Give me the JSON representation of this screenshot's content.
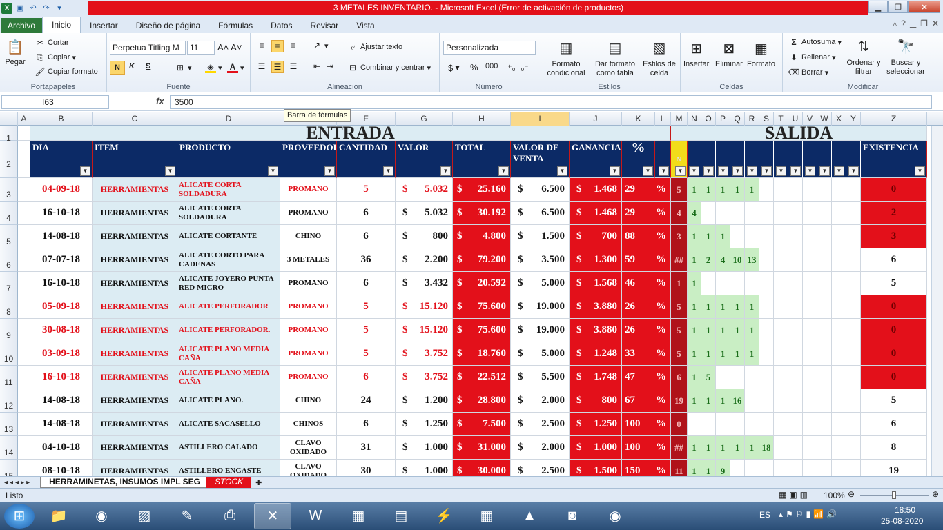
{
  "window": {
    "title": "3 METALES INVENTARIO.  -  Microsoft Excel (Error de activación de productos)"
  },
  "tabs": [
    "Archivo",
    "Inicio",
    "Insertar",
    "Diseño de página",
    "Fórmulas",
    "Datos",
    "Revisar",
    "Vista"
  ],
  "ribbon": {
    "portapapeles": {
      "label": "Portapapeles",
      "paste": "Pegar",
      "cut": "Cortar",
      "copy": "Copiar",
      "format_painter": "Copiar formato"
    },
    "fuente": {
      "label": "Fuente",
      "font": "Perpetua Titling M",
      "size": "11",
      "bold": "N",
      "italic": "K",
      "underline": "S"
    },
    "alineacion": {
      "label": "Alineación",
      "wrap": "Ajustar texto",
      "merge": "Combinar y centrar"
    },
    "numero": {
      "label": "Número",
      "format": "Personalizada",
      "currency": "$",
      "percent": "%",
      "thousands": "000"
    },
    "estilos": {
      "label": "Estilos",
      "conditional": "Formato condicional",
      "table": "Dar formato como tabla",
      "cell_styles": "Estilos de celda"
    },
    "celdas": {
      "label": "Celdas",
      "insert": "Insertar",
      "delete": "Eliminar",
      "format": "Formato"
    },
    "modificar": {
      "label": "Modificar",
      "autosum": "Autosuma",
      "fill": "Rellenar",
      "clear": "Borrar",
      "sort": "Ordenar y filtrar",
      "find": "Buscar y seleccionar"
    }
  },
  "formula_bar": {
    "name_box": "I63",
    "fx": "fx",
    "value": "3500",
    "tooltip": "Barra de fórmulas"
  },
  "columns": [
    "A",
    "B",
    "C",
    "D",
    "E",
    "F",
    "G",
    "H",
    "I",
    "J",
    "K",
    "L",
    "M",
    "N",
    "O",
    "P",
    "Q",
    "R",
    "S",
    "T",
    "U",
    "V",
    "W",
    "X",
    "Y",
    "Z"
  ],
  "headers": {
    "entrada": "ENTRADA",
    "salida": "SALIDA",
    "dia": "DIA",
    "item": "ITEM",
    "producto": "PRODUCTO",
    "proveedor": "PROVEEDOR",
    "cantidad": "CANTIDAD",
    "valor": "VALOR",
    "total": "TOTAL",
    "valor_venta": "VALOR DE VENTA",
    "ganancia": "GANANCIA",
    "pct": "%",
    "n": "N",
    "existencia": "EXISTENCIA"
  },
  "rows": [
    {
      "r": "3",
      "dia": "04-09-18",
      "item": "HERRAMIENTAS",
      "producto": "ALICATE CORTA SOLDADURA",
      "proveedor": "PROMANO",
      "cantidad": "5",
      "valor": "5.032",
      "total": "25.160",
      "venta": "6.500",
      "ganancia": "1.468",
      "pct": "29",
      "n": "5",
      "salidas": [
        "1",
        "1",
        "1",
        "1",
        "1"
      ],
      "exist": "0",
      "red": true
    },
    {
      "r": "4",
      "dia": "16-10-18",
      "item": "HERRAMIENTAS",
      "producto": "ALICATE CORTA SOLDADURA",
      "proveedor": "PROMANO",
      "cantidad": "6",
      "valor": "5.032",
      "total": "30.192",
      "venta": "6.500",
      "ganancia": "1.468",
      "pct": "29",
      "n": "4",
      "salidas": [
        "4"
      ],
      "exist": "2",
      "red": false
    },
    {
      "r": "5",
      "dia": "14-08-18",
      "item": "HERRAMIENTAS",
      "producto": "ALICATE CORTANTE",
      "proveedor": "CHINO",
      "cantidad": "6",
      "valor": "800",
      "total": "4.800",
      "venta": "1.500",
      "ganancia": "700",
      "pct": "88",
      "n": "3",
      "salidas": [
        "1",
        "1",
        "1"
      ],
      "exist": "3",
      "red": false
    },
    {
      "r": "6",
      "dia": "07-07-18",
      "item": "HERRAMIENTAS",
      "producto": "ALICATE CORTO PARA CADENAS",
      "proveedor": "3 METALES",
      "cantidad": "36",
      "valor": "2.200",
      "total": "79.200",
      "venta": "3.500",
      "ganancia": "1.300",
      "pct": "59",
      "n": "##",
      "salidas": [
        "1",
        "2",
        "4",
        "10",
        "13"
      ],
      "exist": "6",
      "red": false
    },
    {
      "r": "7",
      "dia": "16-10-18",
      "item": "HERRAMIENTAS",
      "producto": "ALICATE JOYERO PUNTA RED MICRO",
      "proveedor": "PROMANO",
      "cantidad": "6",
      "valor": "3.432",
      "total": "20.592",
      "venta": "5.000",
      "ganancia": "1.568",
      "pct": "46",
      "n": "1",
      "salidas": [
        "1"
      ],
      "exist": "5",
      "red": false
    },
    {
      "r": "8",
      "dia": "05-09-18",
      "item": "HERRAMIENTAS",
      "producto": "ALICATE PERFORADOR",
      "proveedor": "PROMANO",
      "cantidad": "5",
      "valor": "15.120",
      "total": "75.600",
      "venta": "19.000",
      "ganancia": "3.880",
      "pct": "26",
      "n": "5",
      "salidas": [
        "1",
        "1",
        "1",
        "1",
        "1"
      ],
      "exist": "0",
      "red": true
    },
    {
      "r": "9",
      "dia": "30-08-18",
      "item": "HERRAMIENTAS",
      "producto": "ALICATE PERFORADOR.",
      "proveedor": "PROMANO",
      "cantidad": "5",
      "valor": "15.120",
      "total": "75.600",
      "venta": "19.000",
      "ganancia": "3.880",
      "pct": "26",
      "n": "5",
      "salidas": [
        "1",
        "1",
        "1",
        "1",
        "1"
      ],
      "exist": "0",
      "red": true
    },
    {
      "r": "10",
      "dia": "03-09-18",
      "item": "HERRAMIENTAS",
      "producto": "ALICATE PLANO MEDIA CAÑA",
      "proveedor": "PROMANO",
      "cantidad": "5",
      "valor": "3.752",
      "total": "18.760",
      "venta": "5.000",
      "ganancia": "1.248",
      "pct": "33",
      "n": "5",
      "salidas": [
        "1",
        "1",
        "1",
        "1",
        "1"
      ],
      "exist": "0",
      "red": true
    },
    {
      "r": "11",
      "dia": "16-10-18",
      "item": "HERRAMIENTAS",
      "producto": "ALICATE PLANO MEDIA CAÑA",
      "proveedor": "PROMANO",
      "cantidad": "6",
      "valor": "3.752",
      "total": "22.512",
      "venta": "5.500",
      "ganancia": "1.748",
      "pct": "47",
      "n": "6",
      "salidas": [
        "1",
        "5"
      ],
      "exist": "0",
      "red": true
    },
    {
      "r": "12",
      "dia": "14-08-18",
      "item": "HERRAMIENTAS",
      "producto": "ALICATE PLANO.",
      "proveedor": "CHINO",
      "cantidad": "24",
      "valor": "1.200",
      "total": "28.800",
      "venta": "2.000",
      "ganancia": "800",
      "pct": "67",
      "n": "19",
      "salidas": [
        "1",
        "1",
        "1",
        "16"
      ],
      "exist": "5",
      "red": false
    },
    {
      "r": "13",
      "dia": "14-08-18",
      "item": "HERRAMIENTAS",
      "producto": "ALICATE SACASELLO",
      "proveedor": "CHINOS",
      "cantidad": "6",
      "valor": "1.250",
      "total": "7.500",
      "venta": "2.500",
      "ganancia": "1.250",
      "pct": "100",
      "n": "0",
      "salidas": [],
      "exist": "6",
      "red": false
    },
    {
      "r": "14",
      "dia": "04-10-18",
      "item": "HERRAMIENTAS",
      "producto": "ASTILLERO  CALADO",
      "proveedor": "CLAVO OXIDADO",
      "cantidad": "31",
      "valor": "1.000",
      "total": "31.000",
      "venta": "2.000",
      "ganancia": "1.000",
      "pct": "100",
      "n": "##",
      "salidas": [
        "1",
        "1",
        "1",
        "1",
        "1",
        "18"
      ],
      "exist": "8",
      "red": false
    },
    {
      "r": "15",
      "dia": "08-10-18",
      "item": "HERRAMIENTAS",
      "producto": "ASTILLERO ENGASTE",
      "proveedor": "CLAVO OXIDADO",
      "cantidad": "30",
      "valor": "1.000",
      "total": "30.000",
      "venta": "2.500",
      "ganancia": "1.500",
      "pct": "150",
      "n": "11",
      "salidas": [
        "1",
        "1",
        "9"
      ],
      "exist": "19",
      "red": false
    }
  ],
  "sheet_tabs": [
    "HERRAMINETAS, INSUMOS IMPL SEG",
    "STOCK"
  ],
  "status": {
    "ready": "Listo",
    "zoom": "100%"
  },
  "clock": {
    "lang": "ES",
    "time": "18:50",
    "date": "25-08-2020"
  },
  "colors": {
    "accent": "#0c2a66",
    "red": "#e3101a",
    "green": "#c9eec4",
    "lightblue": "#dcecf3"
  }
}
